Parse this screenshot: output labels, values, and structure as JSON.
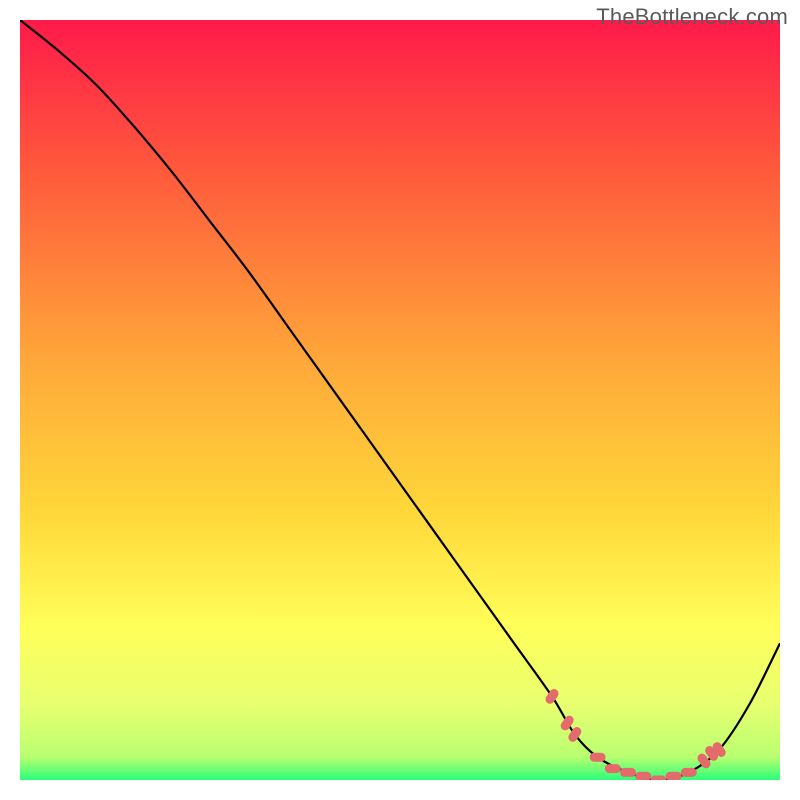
{
  "watermark": "TheBottleneck.com",
  "colors": {
    "bg_top": "#ff1a4a",
    "bg_mid1": "#ff5a3c",
    "bg_mid2": "#ffa83a",
    "bg_mid3": "#ffd83a",
    "bg_mid4": "#ffff5a",
    "bg_low": "#e8ff70",
    "bg_green": "#2bff7a",
    "curve": "#000000",
    "markers": "#e36b6b",
    "background_page": "#ffffff"
  },
  "chart_data": {
    "type": "line",
    "title": "",
    "xlabel": "",
    "ylabel": "",
    "xlim": [
      0,
      100
    ],
    "ylim": [
      0,
      100
    ],
    "series": [
      {
        "name": "curve",
        "x": [
          0,
          5,
          10,
          15,
          20,
          25,
          30,
          35,
          40,
          45,
          50,
          55,
          60,
          65,
          70,
          73,
          76,
          80,
          84,
          88,
          92,
          96,
          100
        ],
        "y": [
          100,
          96,
          91.5,
          86,
          80,
          73.5,
          67,
          60,
          53,
          46,
          39,
          32,
          25,
          18,
          11,
          6,
          3,
          1,
          0,
          1,
          4,
          10,
          18
        ]
      }
    ],
    "markers": [
      {
        "x": 70,
        "y": 11
      },
      {
        "x": 72,
        "y": 7.5
      },
      {
        "x": 73,
        "y": 6
      },
      {
        "x": 76,
        "y": 3
      },
      {
        "x": 78,
        "y": 1.5
      },
      {
        "x": 80,
        "y": 1
      },
      {
        "x": 82,
        "y": 0.5
      },
      {
        "x": 84,
        "y": 0
      },
      {
        "x": 86,
        "y": 0.5
      },
      {
        "x": 88,
        "y": 1
      },
      {
        "x": 90,
        "y": 2.5
      },
      {
        "x": 91,
        "y": 3.5
      },
      {
        "x": 92,
        "y": 4
      }
    ],
    "gradient_stops_pct": [
      {
        "offset": 0,
        "color": "#ff1a4a"
      },
      {
        "offset": 20,
        "color": "#ff5a3c"
      },
      {
        "offset": 45,
        "color": "#ffa83a"
      },
      {
        "offset": 65,
        "color": "#ffd83a"
      },
      {
        "offset": 80,
        "color": "#ffff5a"
      },
      {
        "offset": 90,
        "color": "#e8ff70"
      },
      {
        "offset": 97,
        "color": "#b8ff70"
      },
      {
        "offset": 100,
        "color": "#2bff7a"
      }
    ]
  }
}
